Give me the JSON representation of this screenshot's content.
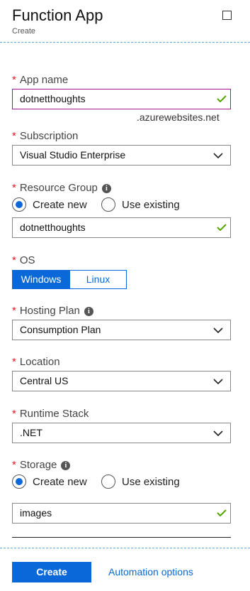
{
  "header": {
    "title": "Function App",
    "subtitle": "Create"
  },
  "required_mark": "*",
  "app_name": {
    "label": "App name",
    "value": "dotnetthoughts",
    "suffix": ".azurewebsites.net"
  },
  "subscription": {
    "label": "Subscription",
    "value": "Visual Studio Enterprise"
  },
  "resource_group": {
    "label": "Resource Group",
    "create_new": "Create new",
    "use_existing": "Use existing",
    "selected": "create_new",
    "value": "dotnetthoughts"
  },
  "os": {
    "label": "OS",
    "options": [
      "Windows",
      "Linux"
    ],
    "selected": "Windows"
  },
  "hosting_plan": {
    "label": "Hosting Plan",
    "value": "Consumption Plan"
  },
  "location": {
    "label": "Location",
    "value": "Central US"
  },
  "runtime_stack": {
    "label": "Runtime Stack",
    "value": ".NET"
  },
  "storage": {
    "label": "Storage",
    "create_new": "Create new",
    "use_existing": "Use existing",
    "selected": "create_new",
    "value": "images"
  },
  "footer": {
    "create_label": "Create",
    "automation_label": "Automation options"
  },
  "colors": {
    "accent": "#0a68d8",
    "required": "#e0161b",
    "valid": "#57a300",
    "focus_border": "#a0168c"
  },
  "icons": {
    "valid": "checkmark-icon",
    "dropdown": "chevron-down-icon",
    "info": "info-icon",
    "maximize": "maximize-icon"
  }
}
